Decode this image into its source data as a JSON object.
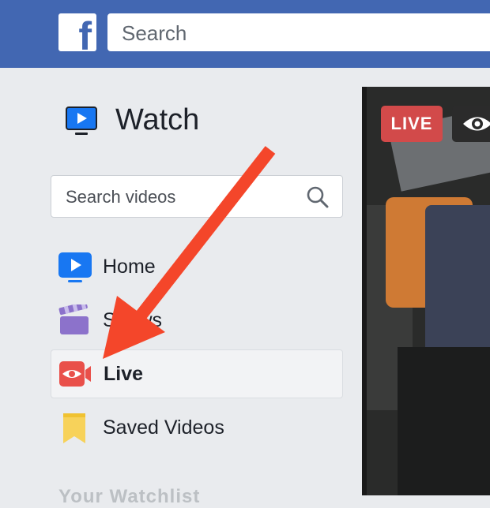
{
  "topbar": {
    "logo_letter": "f",
    "search_placeholder": "Search"
  },
  "watch": {
    "title": "Watch"
  },
  "video_search": {
    "placeholder": "Search videos"
  },
  "nav": [
    {
      "label": "Home",
      "icon": "home-video-icon",
      "active": false
    },
    {
      "label": "Shows",
      "icon": "clapperboard-icon",
      "active": false
    },
    {
      "label": "Live",
      "icon": "live-camera-icon",
      "active": true
    },
    {
      "label": "Saved Videos",
      "icon": "bookmark-icon",
      "active": false
    }
  ],
  "faded_section": "Your Watchlist",
  "player": {
    "live_badge": "LIVE",
    "viewer_icon": "eye-icon"
  },
  "colors": {
    "brand_blue": "#4267b2",
    "live_red": "#e9504a",
    "annotation_arrow": "#f4462a",
    "shows_purple": "#8c72cb",
    "saved_yellow": "#f7d25a"
  }
}
